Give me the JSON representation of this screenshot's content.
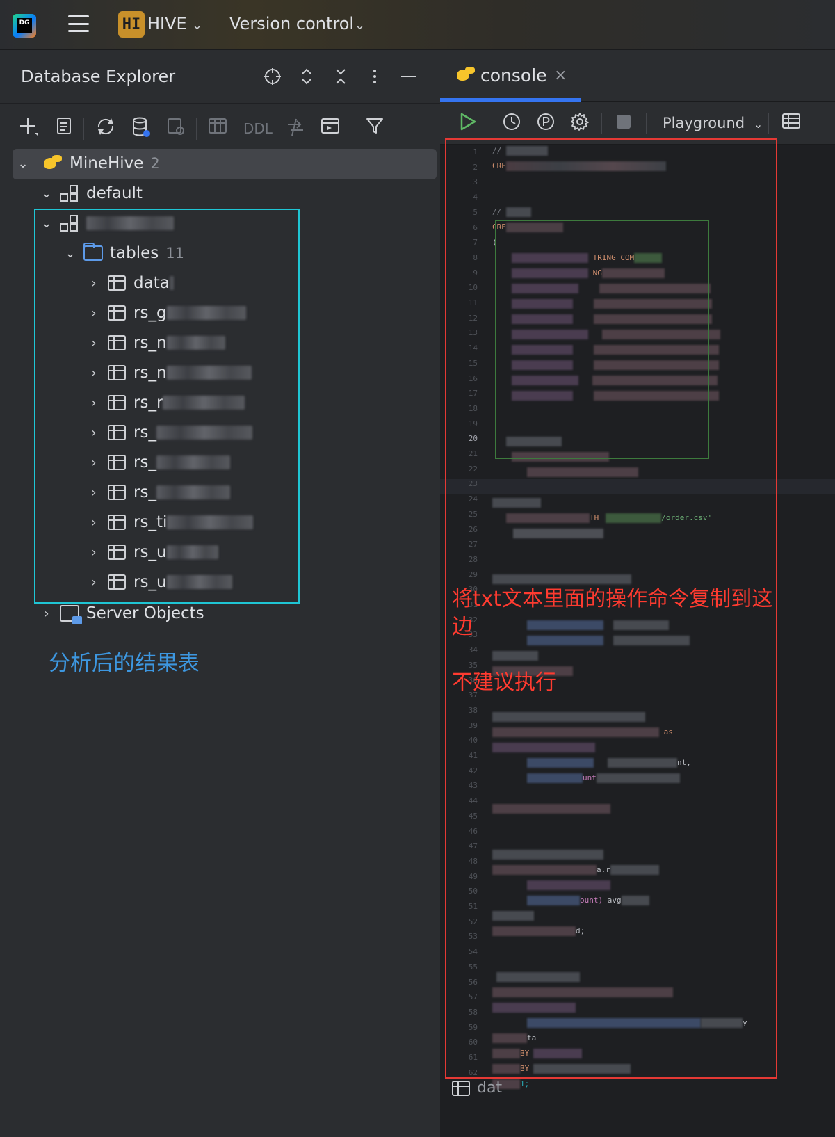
{
  "titlebar": {
    "app_logo_text": "DG",
    "project_badge": "HI",
    "project_name": "HIVE",
    "version_control": "Version control",
    "chevron": "⌄"
  },
  "explorer": {
    "title": "Database Explorer",
    "toolbar": {
      "ddl_label": "DDL"
    },
    "tree": {
      "datasource": {
        "name": "MineHive",
        "count": "2"
      },
      "schema_default": "default",
      "tables_folder": {
        "name": "tables",
        "count": "11"
      },
      "tables": [
        "data",
        "rs_g",
        "rs_n",
        "rs_n",
        "rs_r",
        "rs_",
        "rs_",
        "rs_",
        "rs_ti",
        "rs_u",
        "rs_u"
      ],
      "server_objects": "Server Objects"
    },
    "annotation": "分析后的结果表"
  },
  "editor": {
    "tab_label": "console",
    "tab_close": "×",
    "playground_label": "Playground",
    "snippets": {
      "l1": "//",
      "l2": "CRE",
      "l5": "//",
      "l6": "CRE",
      "l7": "(",
      "l8": "TRING COM",
      "l9": "NG",
      "l25": "/order.csv'",
      "l25b": "TH",
      "l39": "as",
      "l41": "nt,",
      "l42": "unt",
      "l48": "a.r",
      "l50": "ount)",
      "l50b": "avg",
      "l52": "d;",
      "l58": "y",
      "l59": "ta",
      "l60": "BY",
      "l61": "BY",
      "l62": "1;"
    },
    "annotation_copy": "将txt文本里面的操作命令复制到这边",
    "annotation_warn": "不建议执行",
    "bottom_tab": "dat"
  },
  "colors": {
    "accent": "#3574f0",
    "cyan_box": "#1fc5d4",
    "red_box": "#e53935",
    "green_box": "#3d7a3d",
    "annotation_blue": "#3d97e0",
    "annotation_red": "#ff3b30"
  },
  "icons": {
    "hamburger": "menu-icon",
    "locate": "crosshair-icon",
    "expand": "expand-all-icon",
    "collapse": "collapse-all-icon",
    "more": "more-vertical-icon",
    "minimize": "minimize-icon",
    "run": "run-icon",
    "history": "history-icon",
    "params": "parameters-icon",
    "settings": "gear-icon",
    "stop": "stop-icon"
  }
}
